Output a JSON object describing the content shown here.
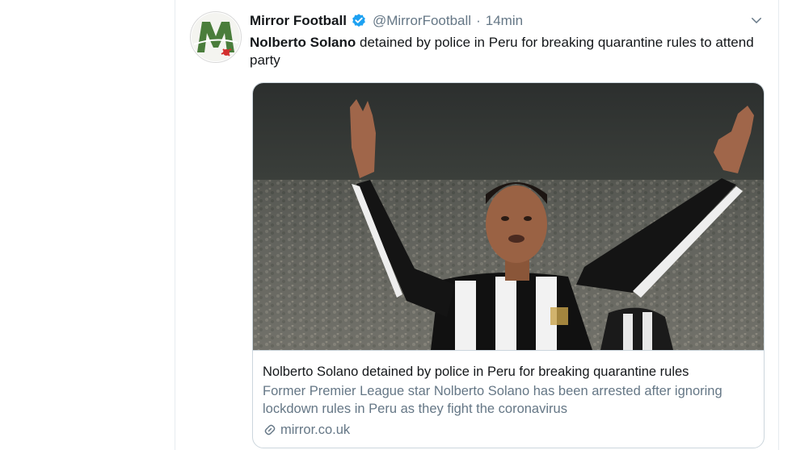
{
  "tweet": {
    "author_name": "Mirror Football",
    "handle": "@MirrorFootball",
    "separator": "·",
    "time": "14min",
    "text_bold": "Nolberto Solano",
    "text_rest": " detained by police in Peru for breaking quarantine rules to attend party"
  },
  "card": {
    "title": "Nolberto Solano detained by police in Peru for breaking quarantine rules",
    "description": "Former Premier League star Nolberto Solano has been arrested after ignoring lockdown rules in Peru as they fight the coronavirus",
    "domain": "mirror.co.uk"
  },
  "colors": {
    "brand_green": "#3d7a3a",
    "verified_blue": "#1da1f2",
    "secondary_text": "#657786",
    "border": "#ccd6dd"
  },
  "icons": {
    "verified": "verified-badge-icon",
    "caret": "chevron-down-icon",
    "link": "link-icon"
  }
}
